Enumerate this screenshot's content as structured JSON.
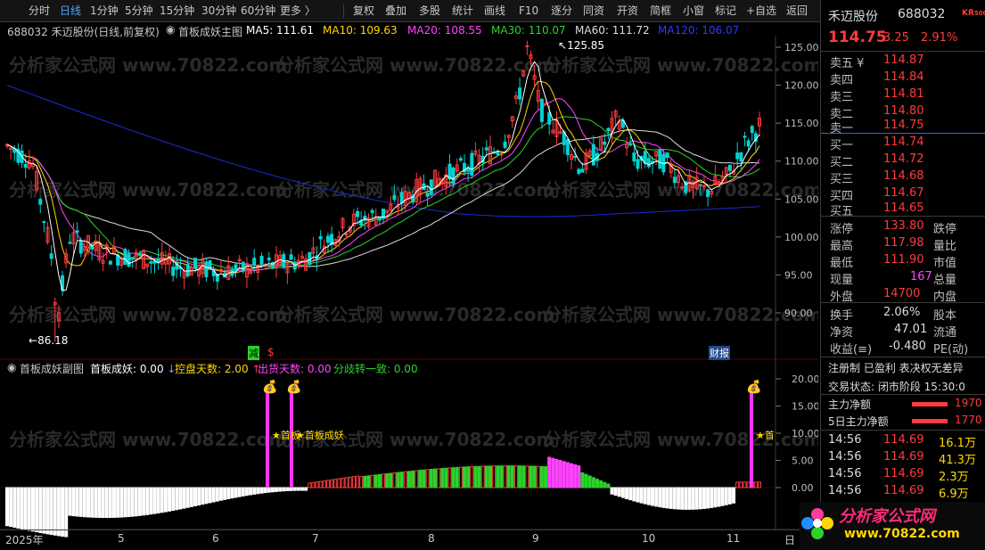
{
  "toolbar": {
    "left_items": [
      "分时",
      "日线",
      "1分钟",
      "5分钟",
      "15分钟",
      "30分钟",
      "60分钟",
      "更多 〉"
    ],
    "active_index": 1,
    "right_items": [
      "复权",
      "叠加",
      "多股",
      "统计",
      "画线",
      "F10",
      "逐分",
      "同资",
      "开资",
      "简框",
      "小窗",
      "标记",
      "+自选",
      "返回"
    ]
  },
  "main_header": {
    "stock": "688032 禾迈股份(日线,前复权)",
    "indicator": "首板成妖主图",
    "ma5": "MA5: 111.61",
    "ma10": "MA10: 109.63",
    "ma20": "MA20: 108.55",
    "ma30": "MA30: 110.07",
    "ma60": "MA60: 111.72",
    "ma120": "MA120: 106.07"
  },
  "main_axis": {
    "ticks": [
      "125.00",
      "120.00",
      "115.00",
      "110.00",
      "105.00",
      "100.00",
      "95.00",
      "90.00"
    ],
    "high_label": "125.85",
    "low_label": "86.18",
    "marker_jian": "减",
    "marker_s": "$",
    "marker_caibao": "财​报"
  },
  "sub_header": {
    "title": "首板成妖副图",
    "v1": "首板成妖: 0.00",
    "v2": "控盘天数: 2.00",
    "v3": "出货天数: 0.00",
    "v4": "分歧转一致: 0.00"
  },
  "sub_axis": {
    "ticks": [
      "20.00",
      "15.00",
      "10.00",
      "5.00",
      "0.00"
    ],
    "annot1": "★首板",
    "annot2": "★首板成妖",
    "annot3": "★首"
  },
  "x_axis": [
    "2025年",
    "5",
    "6",
    "7",
    "8",
    "9",
    "10",
    "11",
    "日"
  ],
  "watermark": "分析家公式网 www.70822.com",
  "quote": {
    "name": "禾迈股份",
    "code": "688032",
    "badge": "KR",
    "badge2": "500",
    "price": "114.75",
    "change": "3.25",
    "pct": "2.91%",
    "asks": [
      {
        "label": "卖五",
        "mark": "¥",
        "price": "114.87"
      },
      {
        "label": "卖四",
        "mark": "",
        "price": "114.84"
      },
      {
        "label": "卖三",
        "mark": "",
        "price": "114.81"
      },
      {
        "label": "卖二",
        "mark": "",
        "price": "114.80"
      },
      {
        "label": "卖一",
        "mark": "",
        "price": "114.75"
      }
    ],
    "bids": [
      {
        "label": "买一",
        "price": "114.74"
      },
      {
        "label": "买二",
        "price": "114.72"
      },
      {
        "label": "买三",
        "price": "114.68"
      },
      {
        "label": "买四",
        "price": "114.67"
      },
      {
        "label": "买五",
        "price": "114.65"
      }
    ],
    "stats": [
      {
        "l": "涨停",
        "v": "133.80",
        "r": "跌停"
      },
      {
        "l": "最高",
        "v": "117.98",
        "r": "量比"
      },
      {
        "l": "最低",
        "v": "111.90",
        "r": "市值"
      },
      {
        "l": "现量",
        "v": "167",
        "r": "总量"
      },
      {
        "l": "外盘",
        "v": "14700",
        "r": "内盘"
      }
    ],
    "stats2": [
      {
        "l": "换手",
        "v": "2.06%",
        "r": "股本"
      },
      {
        "l": "净资",
        "v": "47.01",
        "r": "流通"
      },
      {
        "l": "收益(≡)",
        "v": "-0.480",
        "r": "PE(动)"
      }
    ],
    "tags": "注册制 已盈利 表决权无差异",
    "status": "交易状态: 闭市阶段 15:30:0",
    "flow1": {
      "l": "主力净额",
      "v": "1970"
    },
    "flow2": {
      "l": "5日主力净额",
      "v": "1770"
    },
    "ticks": [
      {
        "t": "14:56",
        "p": "114.69",
        "v": "16.1万"
      },
      {
        "t": "14:56",
        "p": "114.69",
        "v": "41.3万"
      },
      {
        "t": "14:56",
        "p": "114.69",
        "v": "2.3万"
      },
      {
        "t": "14:56",
        "p": "114.69",
        "v": "6.9万"
      }
    ],
    "logo_text": "分析家公式网",
    "logo_url": "www.70822.com"
  },
  "colors": {
    "up": "#ff3b3b",
    "down": "#00d2d2",
    "ma5": "#ffffff",
    "ma10": "#ffd700",
    "ma20": "#ff44ff",
    "ma30": "#2bd22b",
    "ma60": "#dcdcdc",
    "ma120": "#1e2ad8"
  }
}
